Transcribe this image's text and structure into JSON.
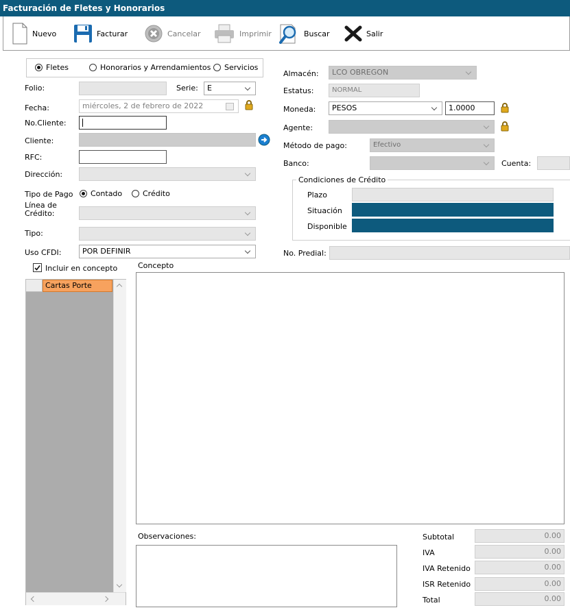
{
  "window": {
    "title": "Facturación de Fletes y Honorarios"
  },
  "toolbar": {
    "nuevo": "Nuevo",
    "facturar": "Facturar",
    "cancelar": "Cancelar",
    "imprimir": "Imprimir",
    "buscar": "Buscar",
    "salir": "Salir"
  },
  "tipo_doc": {
    "fletes": "Fletes",
    "honorarios": "Honorarios y Arrendamientos",
    "servicios": "Servicios",
    "selected": "Fletes"
  },
  "labels": {
    "folio": "Folio:",
    "serie": "Serie:",
    "fecha": "Fecha:",
    "no_cliente": "No.Cliente:",
    "cliente": "Cliente:",
    "rfc": "RFC:",
    "direccion": "Dirección:",
    "tipo_pago": "Tipo de Pago",
    "linea_credito": "Línea de Crédito:",
    "tipo": "Tipo:",
    "uso_cfdi": "Uso CFDI:",
    "almacen": "Almacén:",
    "estatus": "Estatus:",
    "moneda": "Moneda:",
    "agente": "Agente:",
    "metodo_pago": "Método de pago:",
    "banco": "Banco:",
    "cuenta": "Cuenta:",
    "condiciones": "Condiciones de Crédito",
    "plazo": "Plazo",
    "situacion": "Situación",
    "disponible": "Disponible",
    "no_predial": "No. Predial:",
    "incluir": "Incluir en concepto",
    "concepto": "Concepto",
    "observaciones": "Observaciones:",
    "subtotal": "Subtotal",
    "iva": "IVA",
    "iva_retenido": "IVA Retenido",
    "isr_retenido": "ISR Retenido",
    "total": "Total"
  },
  "values": {
    "folio": "",
    "serie": "E",
    "fecha": "miércoles,   2 de   febrero   de 2022",
    "no_cliente": "",
    "cliente": "",
    "rfc": "",
    "direccion": "",
    "tipo_pago_contado": "Contado",
    "tipo_pago_credito": "Crédito",
    "tipo_pago_selected": "Contado",
    "linea_credito": "",
    "tipo": "",
    "uso_cfdi": "POR DEFINIR",
    "almacen": "LCO OBREGON",
    "estatus": "NORMAL",
    "moneda": "PESOS",
    "tipo_cambio": "1.0000",
    "agente": "",
    "metodo_pago": "Efectivo",
    "banco": "",
    "cuenta": "",
    "plazo": "",
    "no_predial": "",
    "incluir_checked": true
  },
  "grid": {
    "header": "Cartas Porte"
  },
  "totals": {
    "subtotal": "0.00",
    "iva": "0.00",
    "iva_retenido": "0.00",
    "isr_retenido": "0.00",
    "total": "0.00"
  },
  "colors": {
    "accent": "#0d5a7d",
    "grid_header": "#f7a25e",
    "grid_body": "#acacac"
  }
}
